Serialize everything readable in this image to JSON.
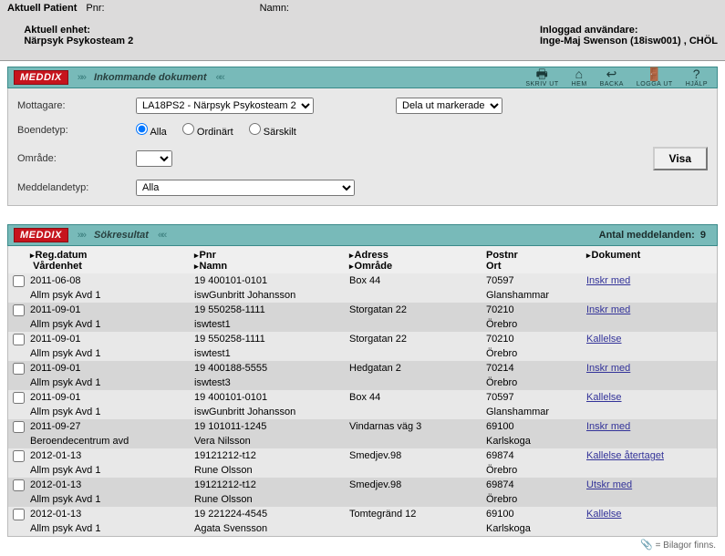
{
  "header": {
    "patient_label": "Aktuell Patient",
    "pnr_label": "Pnr:",
    "pnr_value": "",
    "namn_label": "Namn:",
    "namn_value": "",
    "unit_label": "Aktuell enhet:",
    "unit_value": "Närpsyk Psykosteam 2",
    "loggedin_label": "Inloggad användare:",
    "loggedin_value": "Inge-Maj Swenson (18isw001) , CHÖL"
  },
  "toolbar": {
    "print": "SKRIV UT",
    "home": "HEM",
    "back": "BACKA",
    "logout": "LOGGA UT",
    "help": "HJÄLP"
  },
  "section_incoming": {
    "title": "Inkommande dokument"
  },
  "filter": {
    "mottagare_label": "Mottagare:",
    "mottagare_value": "LA18PS2 - Närpsyk Psykosteam 2",
    "distribute_value": "Dela ut markerade",
    "boendetyp_label": "Boendetyp:",
    "boendetyp_options": {
      "alla": "Alla",
      "ordinart": "Ordinärt",
      "sarskilt": "Särskilt"
    },
    "omrade_label": "Område:",
    "omrade_value": "",
    "meddelandetyp_label": "Meddelandetyp:",
    "meddelandetyp_value": "Alla",
    "visa_label": "Visa"
  },
  "section_results": {
    "title": "Sökresultat",
    "count_label": "Antal meddelanden:",
    "count": "9"
  },
  "columns": {
    "reg": "Reg.datum",
    "reg_sub": "Vårdenhet",
    "pnr": "Pnr",
    "pnr_sub": "Namn",
    "adr": "Adress",
    "adr_sub": "Område",
    "post": "Postnr",
    "post_sub": "Ort",
    "doc": "Dokument"
  },
  "rows": [
    {
      "reg": "2011-06-08",
      "unit": "Allm psyk Avd 1",
      "pnr": "19 400101-0101",
      "namn": "iswGunbritt Johansson",
      "adr": "Box 44",
      "omr": "",
      "post": "70597",
      "ort": "Glanshammar",
      "doc": "Inskr med"
    },
    {
      "reg": "2011-09-01",
      "unit": "Allm psyk Avd 1",
      "pnr": "19 550258-1111",
      "namn": "iswtest1",
      "adr": "Storgatan 22",
      "omr": "",
      "post": "70210",
      "ort": "Örebro",
      "doc": "Inskr med"
    },
    {
      "reg": "2011-09-01",
      "unit": "Allm psyk Avd 1",
      "pnr": "19 550258-1111",
      "namn": "iswtest1",
      "adr": "Storgatan 22",
      "omr": "",
      "post": "70210",
      "ort": "Örebro",
      "doc": "Kallelse"
    },
    {
      "reg": "2011-09-01",
      "unit": "Allm psyk Avd 1",
      "pnr": "19 400188-5555",
      "namn": "iswtest3",
      "adr": "Hedgatan 2",
      "omr": "",
      "post": "70214",
      "ort": "Örebro",
      "doc": "Inskr med"
    },
    {
      "reg": "2011-09-01",
      "unit": "Allm psyk Avd 1",
      "pnr": "19 400101-0101",
      "namn": "iswGunbritt Johansson",
      "adr": "Box 44",
      "omr": "",
      "post": "70597",
      "ort": "Glanshammar",
      "doc": "Kallelse"
    },
    {
      "reg": "2011-09-27",
      "unit": "Beroendecentrum avd",
      "pnr": "19 101011-1245",
      "namn": "Vera Nilsson",
      "adr": "Vindarnas väg 3",
      "omr": "",
      "post": "69100",
      "ort": "Karlskoga",
      "doc": "Inskr med"
    },
    {
      "reg": "2012-01-13",
      "unit": "Allm psyk Avd 1",
      "pnr": "19121212-t12",
      "namn": "Rune Olsson",
      "adr": "Smedjev.98",
      "omr": "",
      "post": "69874",
      "ort": "Örebro",
      "doc": "Kallelse återtaget"
    },
    {
      "reg": "2012-01-13",
      "unit": "Allm psyk Avd 1",
      "pnr": "19121212-t12",
      "namn": "Rune Olsson",
      "adr": "Smedjev.98",
      "omr": "",
      "post": "69874",
      "ort": "Örebro",
      "doc": "Utskr med"
    },
    {
      "reg": "2012-01-13",
      "unit": "Allm psyk Avd 1",
      "pnr": "19 221224-4545",
      "namn": "Agata Svensson",
      "adr": "Tomtegränd 12",
      "omr": "",
      "post": "69100",
      "ort": "Karlskoga",
      "doc": "Kallelse"
    }
  ],
  "footnote": {
    "icon": "📎",
    "text": "= Bilagor finns."
  }
}
